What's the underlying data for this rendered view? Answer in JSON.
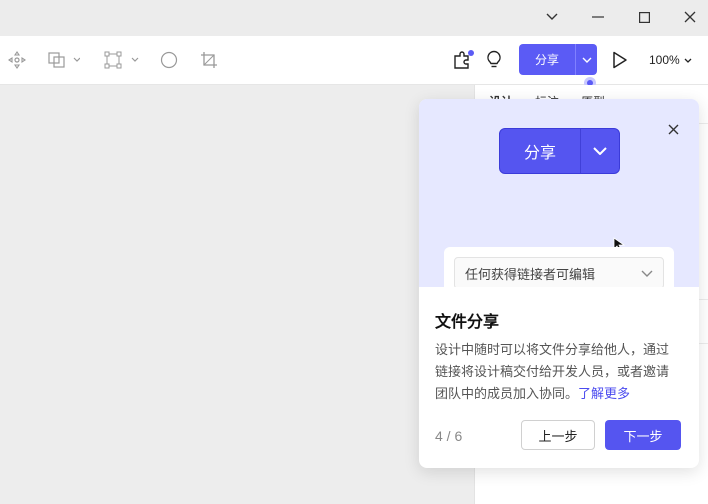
{
  "window": {
    "controls": [
      {
        "name": "chevron-down-icon"
      },
      {
        "name": "minimize-icon"
      },
      {
        "name": "maximize-icon"
      },
      {
        "name": "close-icon"
      }
    ]
  },
  "toolbar": {
    "tools": [
      {
        "icon": "move-icon"
      },
      {
        "icon": "shape-icon"
      },
      {
        "icon": "vector-icon"
      },
      {
        "icon": "ellipse-icon"
      },
      {
        "icon": "crop-icon"
      }
    ],
    "plugin_icon": "plugin-icon",
    "tip_icon": "lightbulb-icon",
    "share_label": "分享",
    "play_icon": "play-icon",
    "zoom": "100%"
  },
  "right_panel": {
    "tabs": [
      "设计",
      "标注",
      "原型"
    ]
  },
  "onboarding": {
    "hero": {
      "share_label": "分享",
      "select_value": "任何获得链接者可编辑"
    },
    "title": "文件分享",
    "description": "设计中随时可以将文件分享给他人，通过链接将设计稿交付给开发人员，或者邀请团队中的成员加入协同。",
    "learn_more": "了解更多",
    "step": "4 / 6",
    "prev_label": "上一步",
    "next_label": "下一步"
  },
  "colors": {
    "accent": "#5b5bf5",
    "hero_bg": "#e6e8ff",
    "canvas_bg": "#ededed"
  }
}
